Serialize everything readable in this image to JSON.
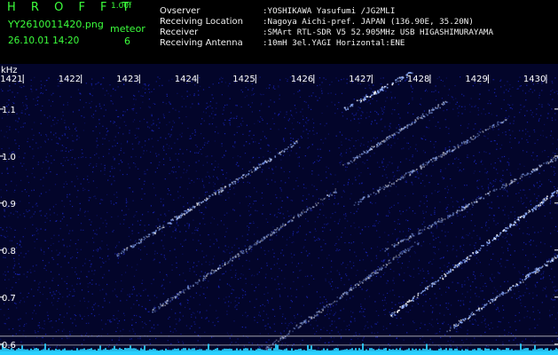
{
  "header": {
    "app_title": "H R O F F T",
    "version": "1.00f",
    "file_name": "YY2610011420.png",
    "datetime": "26.10.01 14:20",
    "meteor_label": "meteor",
    "meteor_count": "6",
    "info": [
      {
        "key": "Ovserver",
        "value": ":YOSHIKAWA Yasufumi /JG2MLI"
      },
      {
        "key": "Receiving Location",
        "value": ":Nagoya Aichi-pref. JAPAN (136.90E, 35.20N)"
      },
      {
        "key": "Receiver",
        "value": ":SMArt RTL-SDR V5 52.905MHz USB HIGASHIMURAYAMA"
      },
      {
        "key": "Receiving Antenna",
        "value": ":10mH 3el.YAGI Horizontal:ENE"
      }
    ]
  },
  "colors": {
    "header_text": "#3cff3c",
    "info_text": "#f0f0f0",
    "plot_background": "#03052a",
    "noise": "#1e2cd8",
    "trail": "#8fb0ff",
    "baseline": "#2ad0ff",
    "frequency_marker": "#d8d8d8"
  },
  "chart_data": {
    "type": "heatmap",
    "y_unit": "kHz",
    "x_tick_labels": [
      "1421",
      "1422",
      "1423",
      "1424",
      "1425",
      "1426",
      "1427",
      "1428",
      "1429",
      "1430"
    ],
    "y_tick_labels": [
      "1.1",
      "1.0",
      "0.9",
      "0.8",
      "0.7",
      "0.6"
    ],
    "y_ticks": [
      1.1,
      1.0,
      0.9,
      0.8,
      0.7,
      0.6
    ],
    "x_range": [
      1420.6,
      1430.2
    ],
    "y_range": [
      0.577,
      1.196
    ],
    "marker_lines_khz": [
      0.617,
      0.598,
      0.584
    ],
    "trails": [
      {
        "x0": 1422.6,
        "y0": 0.79,
        "x1": 1425.7,
        "y1": 1.03,
        "strength": 0.6
      },
      {
        "x0": 1423.2,
        "y0": 0.67,
        "x1": 1426.4,
        "y1": 0.93,
        "strength": 0.35
      },
      {
        "x0": 1424.7,
        "y0": 0.55,
        "x1": 1427.8,
        "y1": 0.82,
        "strength": 0.35
      },
      {
        "x0": 1426.5,
        "y0": 1.1,
        "x1": 1427.7,
        "y1": 1.18,
        "strength": 0.9
      },
      {
        "x0": 1426.5,
        "y0": 0.98,
        "x1": 1428.3,
        "y1": 1.12,
        "strength": 0.5
      },
      {
        "x0": 1426.7,
        "y0": 0.9,
        "x1": 1429.3,
        "y1": 1.08,
        "strength": 0.4
      },
      {
        "x0": 1427.2,
        "y0": 0.8,
        "x1": 1430.2,
        "y1": 1.0,
        "strength": 0.4
      },
      {
        "x0": 1427.3,
        "y0": 0.66,
        "x1": 1430.2,
        "y1": 0.93,
        "strength": 0.85
      },
      {
        "x0": 1428.3,
        "y0": 0.63,
        "x1": 1430.2,
        "y1": 0.79,
        "strength": 0.75
      }
    ]
  }
}
